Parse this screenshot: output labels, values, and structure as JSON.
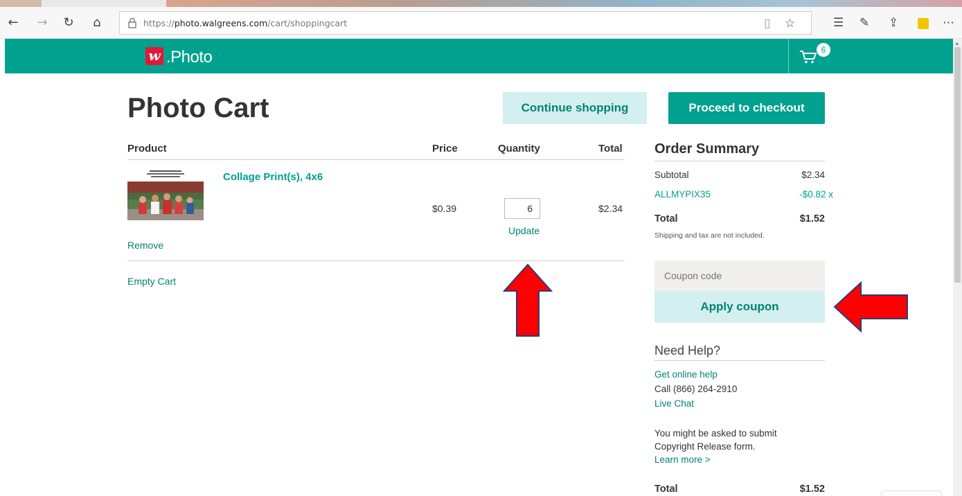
{
  "browser": {
    "url_prefix": "https://",
    "url_domain": "photo.walgreens.com",
    "url_path": "/cart/shoppingcart"
  },
  "header": {
    "logo_mark": "w",
    "logo_text": ".Photo",
    "cart_count": "6",
    "brand_color": "#00a18e"
  },
  "page": {
    "title": "Photo Cart",
    "continue_label": "Continue shopping",
    "checkout_label": "Proceed to checkout"
  },
  "cart": {
    "columns": [
      "Product",
      "Price",
      "Quantity",
      "Total"
    ],
    "items": [
      {
        "name": "Collage Print(s), 4x6",
        "price": "$0.39",
        "quantity": "6",
        "total": "$2.34",
        "update_label": "Update",
        "remove_label": "Remove"
      }
    ],
    "empty_label": "Empty Cart"
  },
  "summary": {
    "title": "Order Summary",
    "subtotal_label": "Subtotal",
    "subtotal_value": "$2.34",
    "coupon_code": "ALLMYPIX35",
    "coupon_value": "-$0.82",
    "coupon_remove": "x",
    "total_label": "Total",
    "total_value": "$1.52",
    "note": "Shipping and tax are not included.",
    "coupon_placeholder": "Coupon code",
    "apply_label": "Apply coupon"
  },
  "help": {
    "title": "Need Help?",
    "online_help": "Get online help",
    "phone": "Call (866) 264-2910",
    "chat": "Live Chat",
    "copyright_line1": "You might be asked to submit",
    "copyright_line2": "Copyright Release form.",
    "learn_more": "Learn more >",
    "bottom_total_label": "Total",
    "bottom_total_value": "$1.52"
  }
}
